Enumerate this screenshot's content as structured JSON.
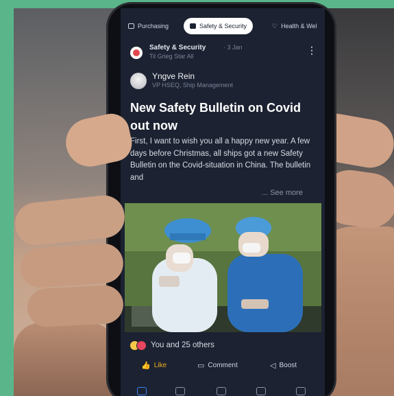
{
  "tabs": [
    {
      "label": "Purchasing",
      "icon": "folder-icon",
      "active": false
    },
    {
      "label": "Safety & Security",
      "icon": "lock-icon",
      "active": true
    },
    {
      "label": "Health & Wel",
      "icon": "heart-icon",
      "active": false
    }
  ],
  "post": {
    "category": "Safety & Security",
    "time": "· 3 Jan",
    "audience": "Til Grieg Star All",
    "author": {
      "name": "Yngve Rein",
      "role": "VP HSEQ, Ship Management"
    },
    "title": "New Safety Bulletin on Covid out now",
    "body": "First, I want to wish you all a happy new year. A few days before Christmas, all ships got a new Safety Bulletin on the Covid-situation in China. The bulletin and",
    "see_more": "... See more",
    "reactions_text": "You and 25 others",
    "actions": {
      "like": "Like",
      "comment": "Comment",
      "boost": "Boost"
    }
  },
  "colors": {
    "screen_bg": "#1c2231",
    "accent_like": "#f2b01e",
    "active_nav": "#3b82f6",
    "frame_green": "#5ab68a"
  }
}
